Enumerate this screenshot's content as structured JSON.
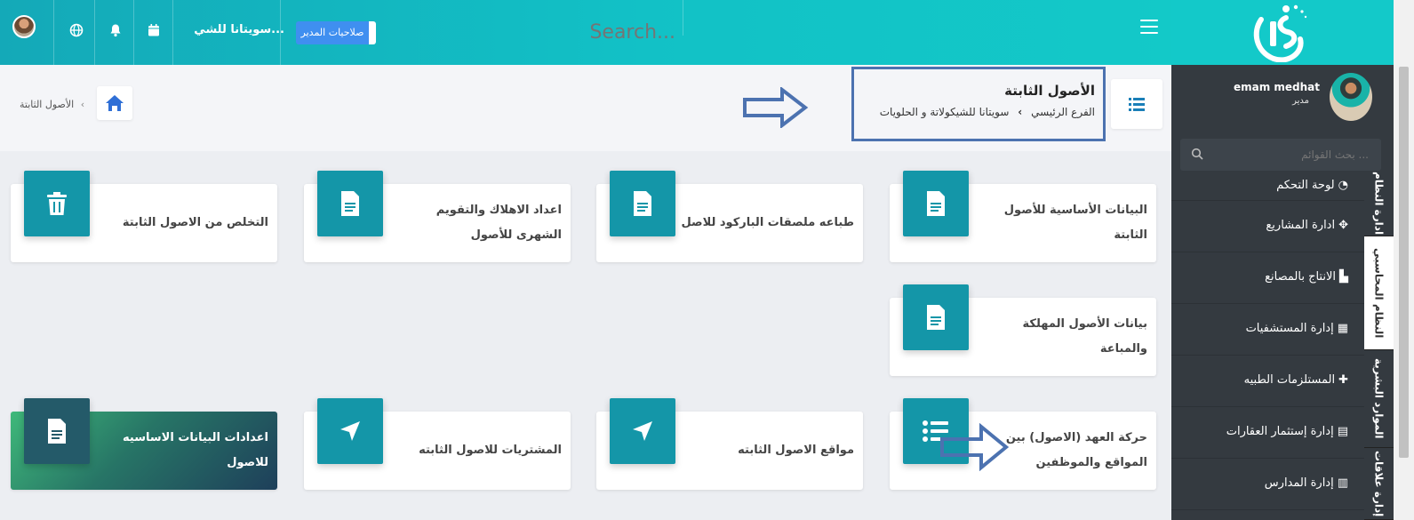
{
  "topbar": {
    "search_placeholder": "Search...",
    "company_name": "سويتانا للشي...",
    "permissions_button": "صلاحيات المدير",
    "icons": [
      "user-avatar",
      "globe-icon",
      "bell-icon",
      "calendar-icon",
      "building-icon",
      "menu-icon"
    ]
  },
  "logo": {
    "brand": "IS"
  },
  "sidebar": {
    "user_name": "emam medhat",
    "user_role": "مدير",
    "search_placeholder": "بحث القوائم ...",
    "items": [
      {
        "label": "لوحة التحكم",
        "icon": "dashboard-icon"
      },
      {
        "label": "ادارة المشاريع",
        "icon": "handshake-icon"
      },
      {
        "label": "الانتاج بالمصانع",
        "icon": "factory-icon"
      },
      {
        "label": "إدارة المستشفيات",
        "icon": "hospital-icon"
      },
      {
        "label": "المستلزمات الطبيه",
        "icon": "medkit-icon"
      },
      {
        "label": "إدارة إستثمار العقارات",
        "icon": "building-icon"
      },
      {
        "label": "إدارة المدارس",
        "icon": "school-icon"
      }
    ],
    "vertical_tabs": [
      "ادارة النظام",
      "النظام المحاسبي",
      "الموارد البشرية",
      "إدارة علاقات"
    ]
  },
  "header": {
    "title": "الأصول الثابتة",
    "company": "سويتانا للشيكولاتة و الحلويات",
    "branch": "الفرع الرئيسي",
    "breadcrumb_current": "الأصول الثابتة"
  },
  "cards": [
    {
      "label": "البيانات الأساسية للأصول الثابتة",
      "icon": "document-icon"
    },
    {
      "label": "طباعه ملصقات الباركود للاصل",
      "icon": "document-icon"
    },
    {
      "label": "اعداد الاهلاك والتقويم الشهرى للأصول",
      "icon": "document-icon"
    },
    {
      "label": "التخلص من الاصول الثابتة",
      "icon": "trash-icon"
    },
    {
      "label": "بيانات الأصول المهلكة والمباعة",
      "icon": "document-icon"
    },
    {
      "label": "حركة العهد (الاصول) بين المواقع والموظفين",
      "icon": "list-icon"
    },
    {
      "label": "مواقع الاصول الثابته",
      "icon": "location-arrow-icon"
    },
    {
      "label": "المشتريات للاصول الثابته",
      "icon": "location-arrow-icon"
    },
    {
      "label": "اعدادات البيانات الاساسيه للاصول",
      "icon": "document-icon"
    }
  ]
}
